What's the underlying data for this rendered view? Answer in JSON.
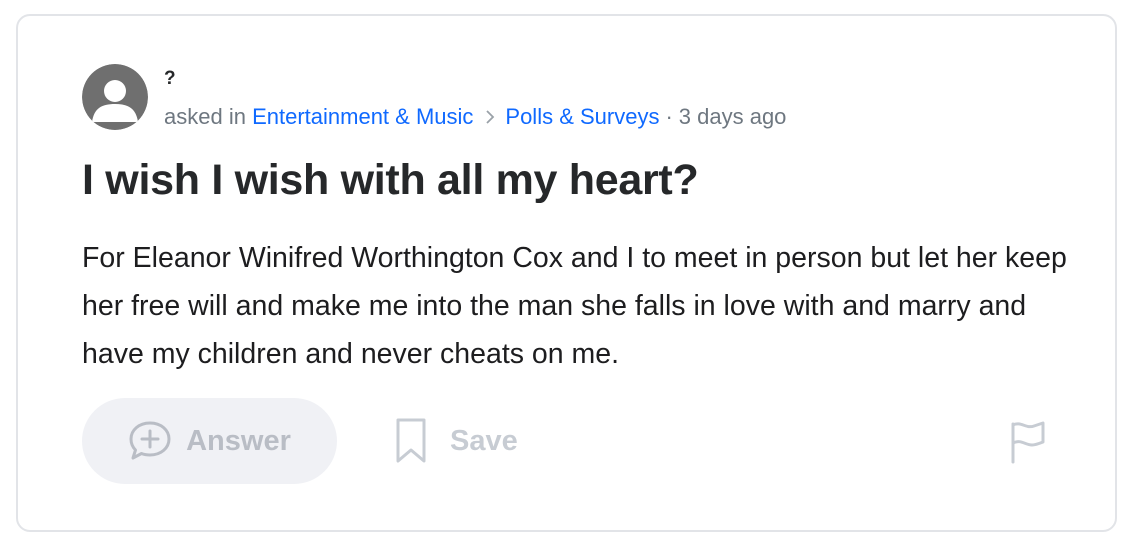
{
  "question": {
    "author": "?",
    "asked_prefix": "asked in",
    "category": "Entertainment & Music",
    "subcategory": "Polls & Surveys",
    "separator": "·",
    "time_ago": "3 days ago",
    "title": "I wish I wish with all my heart?",
    "body": "For Eleanor Winifred Worthington Cox and I to meet in person but let her keep her free will and make me into the man she falls in love with and marry and have my children and never cheats on me."
  },
  "actions": {
    "answer_label": "Answer",
    "save_label": "Save"
  },
  "icons": {
    "avatar": "default-user-avatar",
    "breadcrumb_separator": "chevron-right-icon",
    "answer": "add-comment-icon",
    "save": "bookmark-icon",
    "report": "flag-icon"
  },
  "colors": {
    "link": "#0f69ff",
    "meta_text": "#6e7780",
    "title_text": "#26282a",
    "disabled_text": "#b9bdc5",
    "answer_button_bg": "#f0f1f5",
    "avatar_bg": "#6f6f6f"
  }
}
